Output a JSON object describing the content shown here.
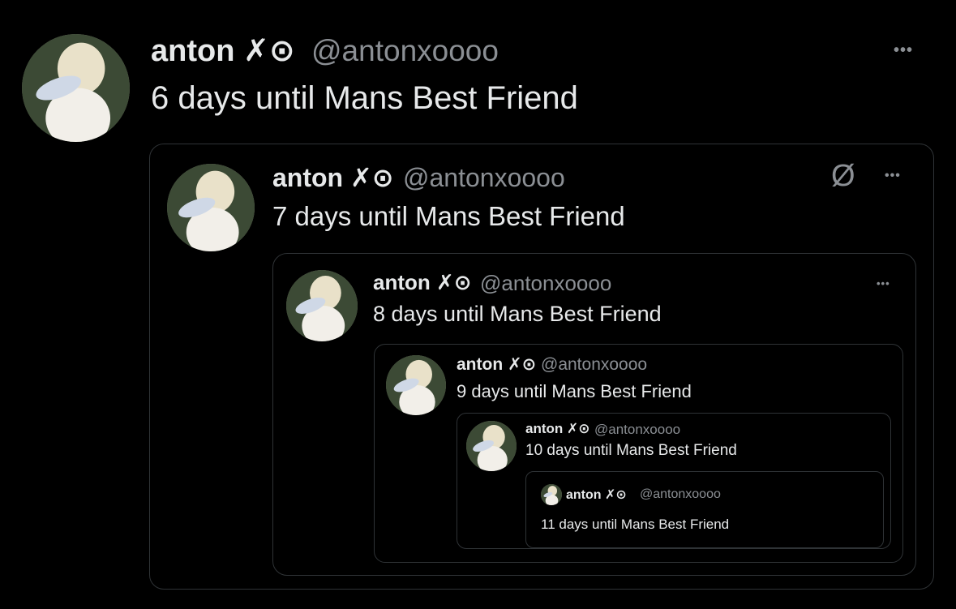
{
  "tweets": [
    {
      "display_name": "anton ✗⊙",
      "handle": "@antonxoooo",
      "text": "6 days until Mans Best Friend",
      "more_label": "•••"
    },
    {
      "display_name": "anton ✗⊙",
      "handle": "@antonxoooo",
      "text": "7 days until Mans Best Friend",
      "more_label": "•••",
      "hidden_icon": "Ø"
    },
    {
      "display_name": "anton ✗⊙",
      "handle": "@antonxoooo",
      "text": "8 days until Mans Best Friend",
      "more_label": "•••"
    },
    {
      "display_name": "anton ✗⊙",
      "handle": "@antonxoooo",
      "text": "9 days until Mans Best Friend"
    },
    {
      "display_name": "anton ✗⊙",
      "handle": "@antonxoooo",
      "text": "10 days until Mans Best Friend"
    },
    {
      "display_name": "anton ✗⊙",
      "handle": "@antonxoooo",
      "text": "11 days until Mans Best Friend"
    }
  ],
  "icons": {
    "avatar": "profile-photo-icon",
    "more": "more-options-icon",
    "hidden": "slashed-circle-icon"
  },
  "colors": {
    "background": "#000000",
    "text_primary": "#e7e9ea",
    "text_secondary": "#8b8f94",
    "border": "#2f3336"
  }
}
